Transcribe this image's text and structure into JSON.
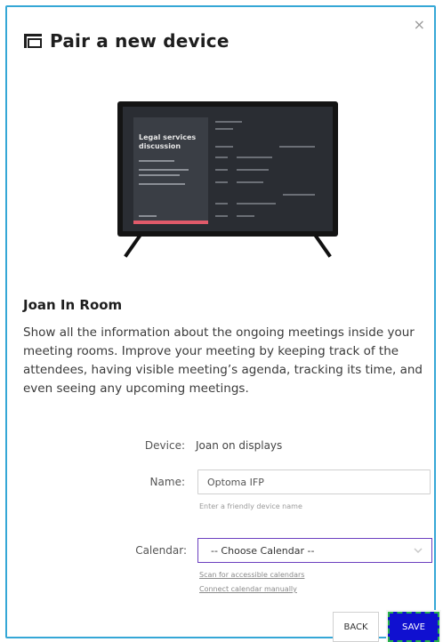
{
  "dialog": {
    "title": "Pair a new device",
    "close_icon": "close-icon"
  },
  "preview": {
    "tv_heading": "Legal services\ndiscussion"
  },
  "section": {
    "title": "Joan In Room",
    "description": "Show all the information about the ongoing meetings inside your meeting rooms. Improve your meeting by keeping track of the attendees, having visible meeting’s agenda, tracking its time, and even seeing any upcoming meetings."
  },
  "form": {
    "device_label": "Device:",
    "device_value": "Joan on displays",
    "name_label": "Name:",
    "name_value": "Optoma IFP",
    "name_hint": "Enter a friendly device name",
    "calendar_label": "Calendar:",
    "calendar_selected": "-- Choose Calendar --",
    "scan_link": "Scan for accessible calendars",
    "connect_link": "Connect calendar manually"
  },
  "buttons": {
    "back": "BACK",
    "save": "SAVE"
  },
  "colors": {
    "border": "#35a7d6",
    "save_bg": "#1010d0",
    "focus_dash": "#27b24a",
    "select_border": "#6b3fbf"
  }
}
